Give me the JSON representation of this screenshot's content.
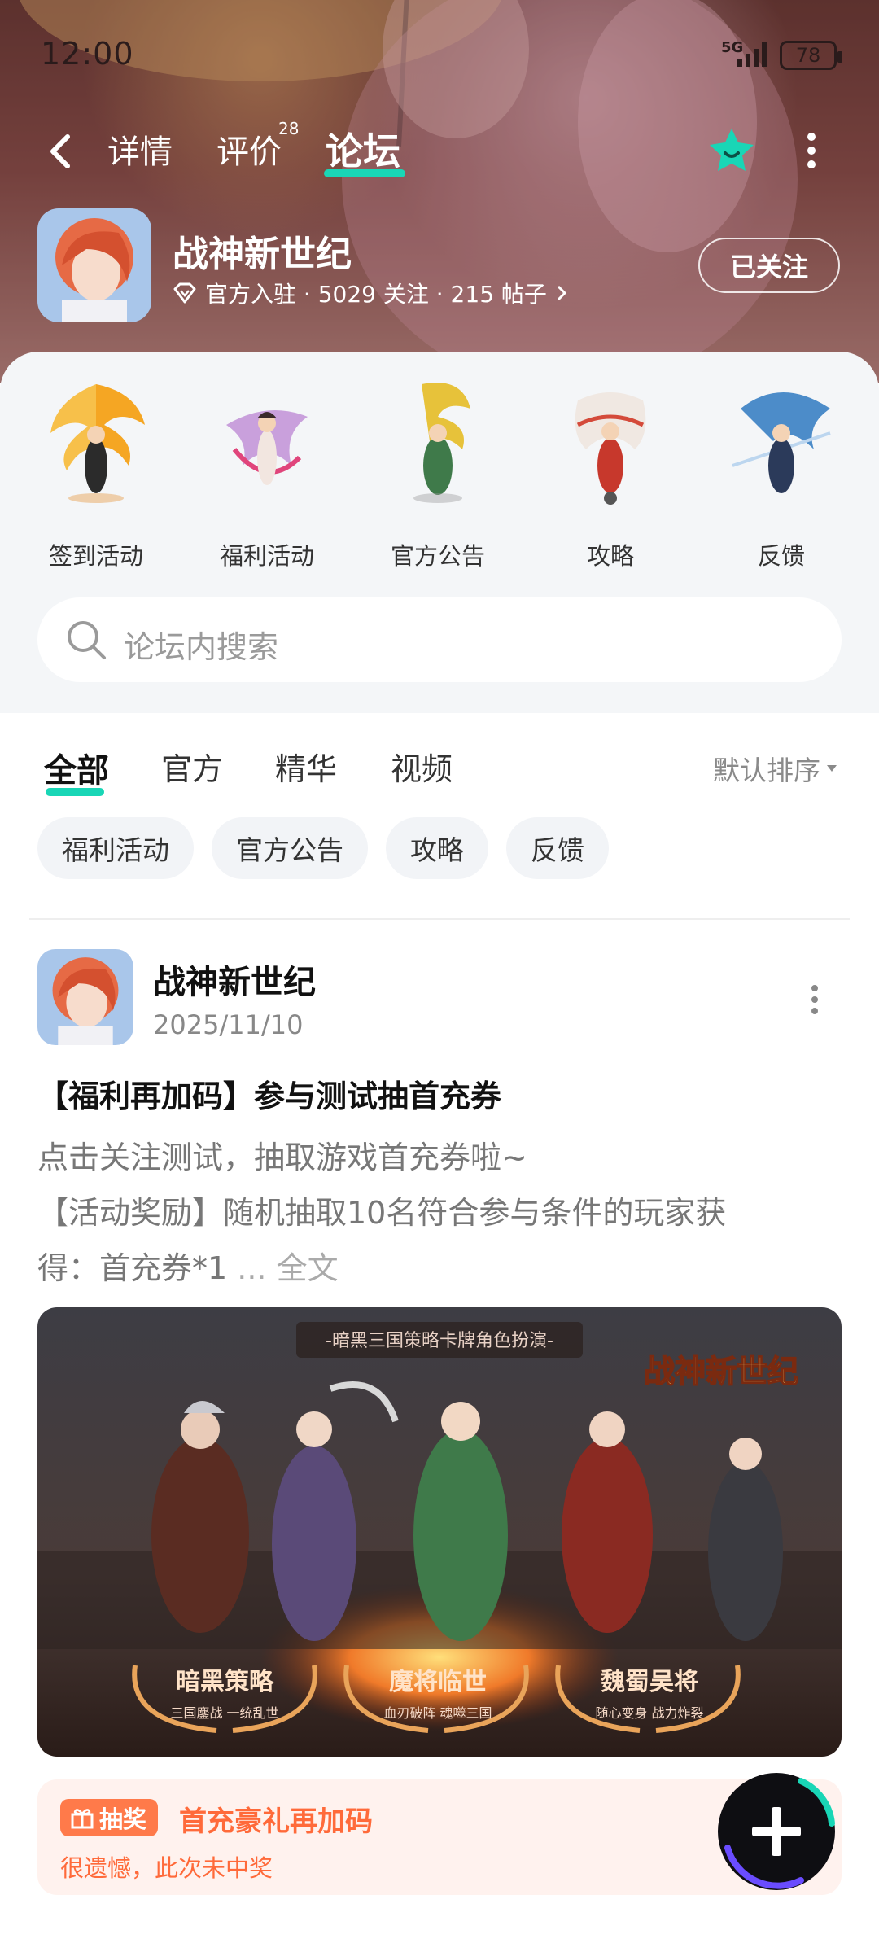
{
  "status_bar": {
    "time": "12:00",
    "network": "5G",
    "battery": "78"
  },
  "nav": {
    "tabs": [
      {
        "label": "详情"
      },
      {
        "label": "评价"
      },
      {
        "label": "论坛"
      }
    ],
    "review_count": "28"
  },
  "game": {
    "title": "战神新世纪",
    "meta": "官方入驻 · 5029 关注 · 215 帖子",
    "follow_label": "已关注"
  },
  "categories": [
    {
      "label": "签到活动"
    },
    {
      "label": "福利活动"
    },
    {
      "label": "官方公告"
    },
    {
      "label": "攻略"
    },
    {
      "label": "反馈"
    }
  ],
  "search": {
    "placeholder": "论坛内搜索"
  },
  "filter_tabs": [
    {
      "label": "全部"
    },
    {
      "label": "官方"
    },
    {
      "label": "精华"
    },
    {
      "label": "视频"
    }
  ],
  "sort_label": "默认排序",
  "chips": [
    {
      "label": "福利活动"
    },
    {
      "label": "官方公告"
    },
    {
      "label": "攻略"
    },
    {
      "label": "反馈"
    }
  ],
  "post": {
    "author": "战神新世纪",
    "date": "2025/11/10",
    "title": "【福利再加码】参与测试抽首充券",
    "body_line1": "点击关注测试，抽取游戏首充券啦~",
    "body_line2": "【活动奖励】随机抽取10名符合参与条件的玩家获",
    "body_line3": "得：首充券*1",
    "ellipsis": " ... ",
    "more_label": "全文",
    "image": {
      "banner_top": "-暗黑三国策略卡牌角色扮演-",
      "logo_text": "战神新世纪",
      "badges": [
        {
          "title": "暗黑策略",
          "sub": "三国鏖战 一统乱世"
        },
        {
          "title": "魔将临世",
          "sub": "血刃破阵 魂噬三国"
        },
        {
          "title": "魏蜀吴将",
          "sub": "随心变身 战力炸裂"
        }
      ]
    },
    "lottery": {
      "badge": "抽奖",
      "title": "首充豪礼再加码",
      "status": "很遗憾，此次未中奖"
    }
  },
  "colors": {
    "accent": "#19d6b6",
    "lottery": "#ff6a3a",
    "lottery_bg": "#fff2ee"
  }
}
